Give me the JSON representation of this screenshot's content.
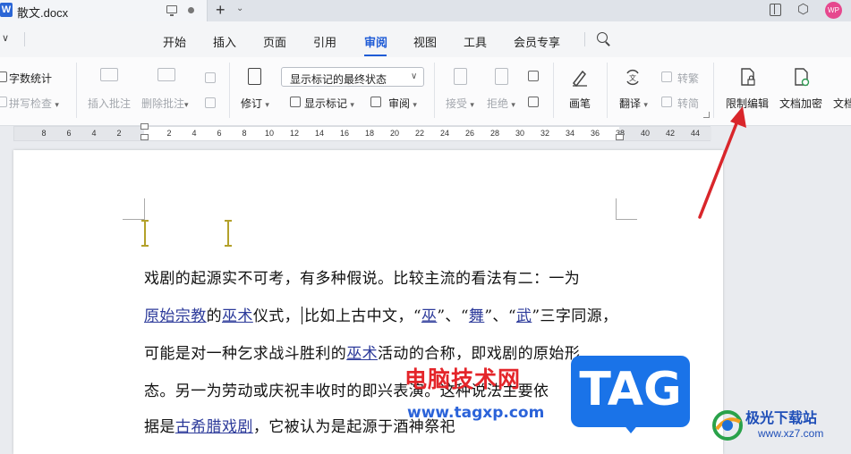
{
  "titlebar": {
    "app_letter": "W",
    "tab_title": "散文.docx",
    "new_tab_symbol": "+",
    "tab_menu_symbol": "⌄",
    "avatar_text": "WP"
  },
  "menu": {
    "items": [
      "开始",
      "插入",
      "页面",
      "引用",
      "审阅",
      "视图",
      "工具",
      "会员专享"
    ],
    "active": "审阅"
  },
  "ribbon": {
    "word_count": "字数统计",
    "spell_check": "拼写检查",
    "insert_comment": "插入批注",
    "delete_comment": "删除批注",
    "track_changes": "修订",
    "display_mode": "显示标记的最终状态",
    "show_markup": "显示标记",
    "review_pane": "审阅",
    "accept": "接受",
    "reject": "拒绝",
    "ink": "画笔",
    "translate": "翻译",
    "to_traditional": "转繁",
    "to_simplified": "转简",
    "restrict_editing": "限制编辑",
    "encrypt_document": "文档加密",
    "document_more": "文档"
  },
  "ruler": {
    "ticks": [
      "8",
      "6",
      "4",
      "2",
      "2",
      "4",
      "6",
      "8",
      "10",
      "12",
      "14",
      "16",
      "18",
      "20",
      "22",
      "24",
      "26",
      "28",
      "30",
      "32",
      "34",
      "36",
      "38",
      "40",
      "42",
      "44"
    ]
  },
  "document": {
    "line1": "戏剧的起源实不可考，有多种假说。比较主流的看法有二：一为",
    "line2": {
      "link1": "原始宗教",
      "t1": "的",
      "link2": "巫术",
      "t2": "仪式，",
      "t3": "比如上古中文，“",
      "link3": "巫",
      "t4": "”、“",
      "link4": "舞",
      "t5": "”、“",
      "link5": "武",
      "t6": "”三字同源，"
    },
    "line3": {
      "t1": "可能是对一种乞求战斗胜利的",
      "link1": "巫术",
      "t2": "活动的合称，即戏剧的原始形"
    },
    "line4": "态。另一为劳动或庆祝丰收时的即兴表演。这种说法主要依",
    "line5": {
      "t1": "据是",
      "link1": "古希腊戏剧",
      "t2": "，它被认为是起源于酒神祭祀"
    }
  },
  "watermarks": {
    "site_name": "电脑技术网",
    "site_url": "www.tagxp.com",
    "badge": "TAG",
    "logo_title": "极光下载站",
    "logo_url": "www.xz7.com"
  },
  "annotation": {
    "arrow_color": "#d9262b"
  }
}
